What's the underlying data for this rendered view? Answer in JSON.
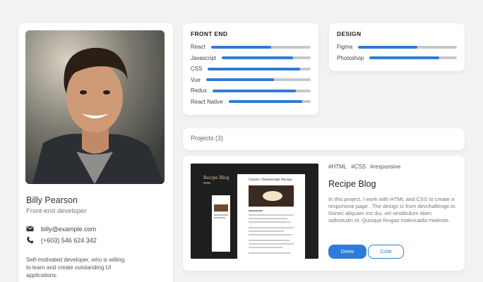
{
  "profile": {
    "name": "Billy Pearson",
    "role": "Front-end developer",
    "email": "billy@example.com",
    "phone": "(+603) 546 624 342",
    "bio": "Self-motivated developer, who is willing to learn and create outstanding UI applications."
  },
  "frontend": {
    "title": "FRONT END",
    "skills": [
      {
        "label": "React",
        "level": 0.6
      },
      {
        "label": "Javascript",
        "level": 0.8
      },
      {
        "label": "CSS",
        "level": 0.9
      },
      {
        "label": "Vue",
        "level": 0.65
      },
      {
        "label": "Redux",
        "level": 0.85
      },
      {
        "label": "React Native",
        "level": 0.9
      }
    ]
  },
  "design": {
    "title": "DESIGN",
    "skills": [
      {
        "label": "Figma",
        "level": 0.6
      },
      {
        "label": "Photoshop",
        "level": 0.8
      }
    ]
  },
  "projects": {
    "header": "Projects (3)",
    "item": {
      "tags": [
        "#HTML",
        "#CSS",
        "#responsive"
      ],
      "title": "Recipe Blog",
      "description": "In this project, I work with HTML and CSS to create a responsive page . The design is from devchallenge.io. Donec aliquam est dui, vel vestibulum diam sollicitudin id. Quisque feugiat malesuada molestie.",
      "demo_label": "Demo",
      "code_label": "Code",
      "thumb_brand": "Recipe Blog",
      "thumb_heading": "Classic Cheesecake Recipe"
    }
  },
  "colors": {
    "accent": "#2e7bd8",
    "track": "#c8c8c8"
  }
}
